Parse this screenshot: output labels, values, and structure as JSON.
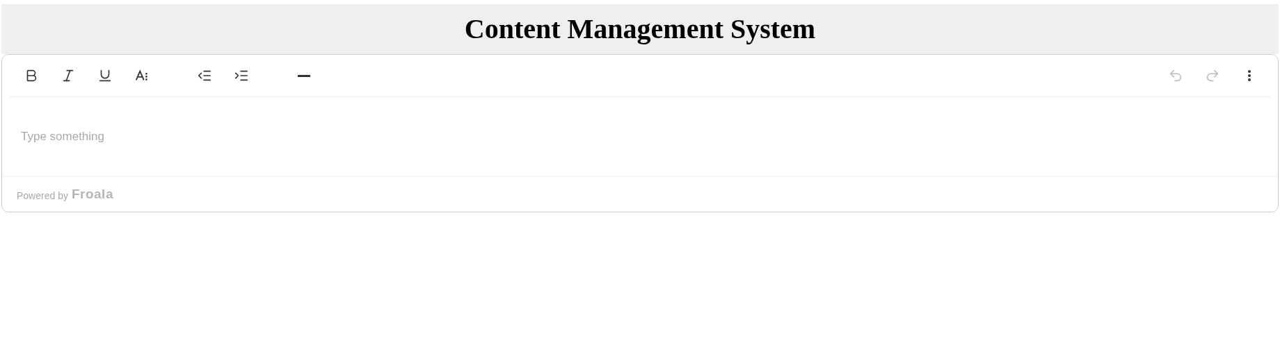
{
  "header": {
    "title": "Content Management System"
  },
  "toolbar": {
    "left_groups": [
      [
        {
          "kind": "bold",
          "disabled": false
        },
        {
          "kind": "italic",
          "disabled": false
        },
        {
          "kind": "underline",
          "disabled": false
        },
        {
          "kind": "font-size",
          "disabled": false
        }
      ],
      [
        {
          "kind": "outdent",
          "disabled": false
        },
        {
          "kind": "indent",
          "disabled": false
        }
      ],
      [
        {
          "kind": "horizontal-line",
          "disabled": false
        }
      ]
    ],
    "right": [
      {
        "kind": "undo",
        "disabled": true
      },
      {
        "kind": "redo",
        "disabled": true
      },
      {
        "kind": "more",
        "disabled": false
      }
    ]
  },
  "editor": {
    "placeholder": "Type something"
  },
  "footer": {
    "powered_by": "Powered by",
    "brand": "Froala"
  }
}
